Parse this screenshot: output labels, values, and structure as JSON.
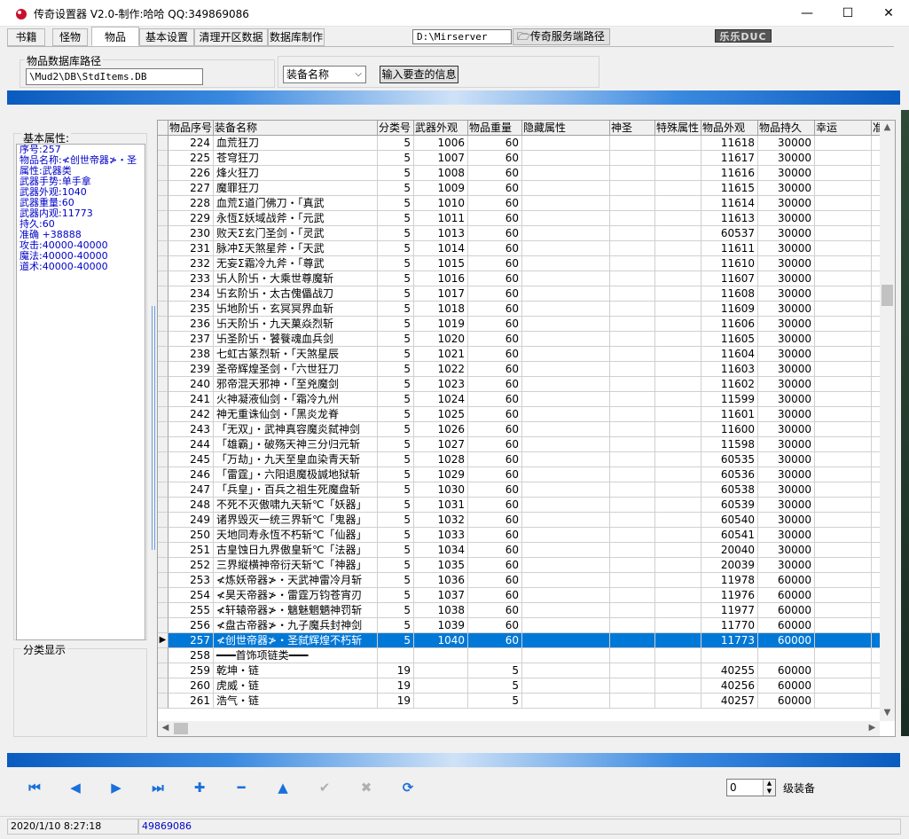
{
  "window": {
    "title": "传奇设置器 V2.0-制作:哈哈 QQ:349869086",
    "minimize": "—",
    "maximize": "☐",
    "close": "✕"
  },
  "tabs": [
    {
      "label": "书籍"
    },
    {
      "label": "怪物"
    },
    {
      "label": "物品"
    },
    {
      "label": "基本设置"
    },
    {
      "label": "清理开区数据"
    },
    {
      "label": "数据库制作"
    }
  ],
  "server": {
    "path_value": "D:\\Mirserver",
    "path_button": "传奇服务端路径",
    "logo_text": "乐乐DUC"
  },
  "db": {
    "legend": "物品数据库路径",
    "path_value": "\\Mud2\\DB\\StdItems.DB"
  },
  "search": {
    "field_value": "装备名称",
    "button_label": "输入要查的信息"
  },
  "left": {
    "attr_legend": "基本属性:",
    "attr_lines": [
      "序号:257",
      "物品名称:≮创世帝器≯・圣",
      "属性:武器类",
      "武器手势:单手拿",
      "武器外观:1040",
      "武器重量:60",
      "武器内观:11773",
      "持久:60",
      "准确 +38888",
      "攻击:40000-40000",
      "魔法:40000-40000",
      "道术:40000-40000"
    ],
    "category_legend": "分类显示"
  },
  "grid": {
    "columns": [
      "物品序号",
      "装备名称",
      "分类号",
      "武器外观",
      "物品重量",
      "隐藏属性",
      "神圣",
      "特殊属性",
      "物品外观",
      "物品持久",
      "幸运",
      "准"
    ],
    "selected_index": 33,
    "rows": [
      [
        "224",
        "血荒狂刀",
        "5",
        "1006",
        "60",
        "",
        "",
        "",
        "11618",
        "30000"
      ],
      [
        "225",
        "苍穹狂刀",
        "5",
        "1007",
        "60",
        "",
        "",
        "",
        "11617",
        "30000"
      ],
      [
        "226",
        "烽火狂刀",
        "5",
        "1008",
        "60",
        "",
        "",
        "",
        "11616",
        "30000"
      ],
      [
        "227",
        "魔罪狂刀",
        "5",
        "1009",
        "60",
        "",
        "",
        "",
        "11615",
        "30000"
      ],
      [
        "228",
        "血荒Σ道门佛刀・「真武",
        "5",
        "1010",
        "60",
        "",
        "",
        "",
        "11614",
        "30000"
      ],
      [
        "229",
        "永恆Σ妖域战斧・「元武",
        "5",
        "1011",
        "60",
        "",
        "",
        "",
        "11613",
        "30000"
      ],
      [
        "230",
        "败天Σ玄门圣剑・「灵武",
        "5",
        "1013",
        "60",
        "",
        "",
        "",
        "60537",
        "30000"
      ],
      [
        "231",
        "脉冲Σ天煞星斧・「天武",
        "5",
        "1014",
        "60",
        "",
        "",
        "",
        "11611",
        "30000"
      ],
      [
        "232",
        "无妄Σ霜冷九斧・「尊武",
        "5",
        "1015",
        "60",
        "",
        "",
        "",
        "11610",
        "30000"
      ],
      [
        "233",
        "卐人阶卐・大乘世尊魔斩",
        "5",
        "1016",
        "60",
        "",
        "",
        "",
        "11607",
        "30000"
      ],
      [
        "234",
        "卐玄阶卐・太古傀儡战刀",
        "5",
        "1017",
        "60",
        "",
        "",
        "",
        "11608",
        "30000"
      ],
      [
        "235",
        "卐地阶卐・玄冥冥界血斩",
        "5",
        "1018",
        "60",
        "",
        "",
        "",
        "11609",
        "30000"
      ],
      [
        "236",
        "卐天阶卐・九天菓焱烈斩",
        "5",
        "1019",
        "60",
        "",
        "",
        "",
        "11606",
        "30000"
      ],
      [
        "237",
        "卐圣阶卐・饕餮魂血兵剑",
        "5",
        "1020",
        "60",
        "",
        "",
        "",
        "11605",
        "30000"
      ],
      [
        "238",
        "七虹古篆烈斩・「天煞星辰",
        "5",
        "1021",
        "60",
        "",
        "",
        "",
        "11604",
        "30000"
      ],
      [
        "239",
        "圣帝辉煌圣剑・「六世狂刀",
        "5",
        "1022",
        "60",
        "",
        "",
        "",
        "11603",
        "30000"
      ],
      [
        "240",
        "邪帝混天邪神・「至兇魔剑",
        "5",
        "1023",
        "60",
        "",
        "",
        "",
        "11602",
        "30000"
      ],
      [
        "241",
        "火神凝液仙剑・「霜冷九州",
        "5",
        "1024",
        "60",
        "",
        "",
        "",
        "11599",
        "30000"
      ],
      [
        "242",
        "神无重诛仙剑・「黑炎龙脊",
        "5",
        "1025",
        "60",
        "",
        "",
        "",
        "11601",
        "30000"
      ],
      [
        "243",
        "「无双」・武神真容魔炎弑神剑",
        "5",
        "1026",
        "60",
        "",
        "",
        "",
        "11600",
        "30000"
      ],
      [
        "244",
        "「雄霸」・破殇天神三分归元斩",
        "5",
        "1027",
        "60",
        "",
        "",
        "",
        "11598",
        "30000"
      ],
      [
        "245",
        "「万劫」・九天至皇血染青天斩",
        "5",
        "1028",
        "60",
        "",
        "",
        "",
        "60535",
        "30000"
      ],
      [
        "246",
        "「雷霆」・六阳退魔极諴地狱斩",
        "5",
        "1029",
        "60",
        "",
        "",
        "",
        "60536",
        "30000"
      ],
      [
        "247",
        "「兵皇」・百兵之祖生死魔盘斩",
        "5",
        "1030",
        "60",
        "",
        "",
        "",
        "60538",
        "30000"
      ],
      [
        "248",
        "不死不灭傲啸九天斩℃「妖器」",
        "5",
        "1031",
        "60",
        "",
        "",
        "",
        "60539",
        "30000"
      ],
      [
        "249",
        "诸界毁灭一统三界斩℃「鬼器」",
        "5",
        "1032",
        "60",
        "",
        "",
        "",
        "60540",
        "30000"
      ],
      [
        "250",
        "天地同寿永恆不朽斩℃「仙器」",
        "5",
        "1033",
        "60",
        "",
        "",
        "",
        "60541",
        "30000"
      ],
      [
        "251",
        "古皇蚀日九界傲皇斩℃「法器」",
        "5",
        "1034",
        "60",
        "",
        "",
        "",
        "20040",
        "30000"
      ],
      [
        "252",
        "三界縦横神帝衍天斩℃「神器」",
        "5",
        "1035",
        "60",
        "",
        "",
        "",
        "20039",
        "30000"
      ],
      [
        "253",
        "≮炼妖帝器≯・天武神雷冷月斩",
        "5",
        "1036",
        "60",
        "",
        "",
        "",
        "11978",
        "60000"
      ],
      [
        "254",
        "≮昊天帝器≯・雷霆万钧苍宵刃",
        "5",
        "1037",
        "60",
        "",
        "",
        "",
        "11976",
        "60000"
      ],
      [
        "255",
        "≮轩辕帝器≯・魑魅魍魉神罚斩",
        "5",
        "1038",
        "60",
        "",
        "",
        "",
        "11977",
        "60000"
      ],
      [
        "256",
        "≮盘古帝器≯・九子魔兵封神剑",
        "5",
        "1039",
        "60",
        "",
        "",
        "",
        "11770",
        "60000"
      ],
      [
        "257",
        "≮创世帝器≯・圣弑辉煌不朽斩",
        "5",
        "1040",
        "60",
        "",
        "",
        "",
        "11773",
        "60000"
      ],
      [
        "258",
        "━━━首饰项链类━━━",
        "",
        "",
        "",
        "",
        "",
        "",
        "",
        ""
      ],
      [
        "259",
        "乾坤・链",
        "19",
        "",
        "5",
        "",
        "",
        "",
        "40255",
        "60000"
      ],
      [
        "260",
        "虎威・链",
        "19",
        "",
        "5",
        "",
        "",
        "",
        "40256",
        "60000"
      ],
      [
        "261",
        "浩气・链",
        "19",
        "",
        "5",
        "",
        "",
        "",
        "40257",
        "60000"
      ]
    ]
  },
  "bottom": {
    "level_value": "0",
    "level_label": "级装备"
  },
  "status": {
    "datetime": "2020/1/10  8:27:18",
    "qq": "49869086"
  },
  "colors": {
    "selection": "#0078d7",
    "nav_icon": "#1a6fdb",
    "attr_text": "#0000c8"
  }
}
